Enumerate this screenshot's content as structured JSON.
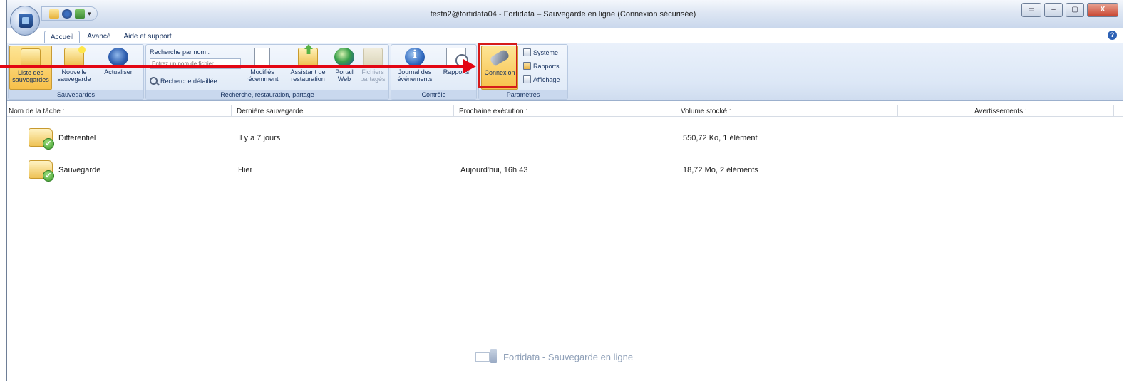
{
  "window": {
    "title": "testn2@fortidata04 - Fortidata – Sauvegarde en ligne (Connexion sécurisée)",
    "close_label": "X"
  },
  "tabs": [
    {
      "label": "Accueil",
      "active": true
    },
    {
      "label": "Avancé",
      "active": false
    },
    {
      "label": "Aide et support",
      "active": false
    }
  ],
  "help_label": "?",
  "ribbon": {
    "groups": {
      "sauvegardes": {
        "label": "Sauvegardes",
        "buttons": [
          {
            "line1": "Liste des",
            "line2": "sauvegardes",
            "selected": true,
            "icon": "folder-icon"
          },
          {
            "line1": "Nouvelle",
            "line2": "sauvegarde",
            "icon": "new-folder-icon"
          },
          {
            "line1": "Actualiser",
            "line2": "",
            "icon": "refresh-icon"
          }
        ]
      },
      "recherche": {
        "label": "Recherche, restauration, partage",
        "search_label": "Recherche par nom :",
        "search_placeholder": "Entrez un nom de fichier",
        "advanced_search": "Recherche détaillée...",
        "buttons": [
          {
            "line1": "Modifiés",
            "line2": "récemment",
            "icon": "recent-docs-icon"
          },
          {
            "line1": "Assistant de",
            "line2": "restauration",
            "icon": "restore-wizard-icon"
          },
          {
            "line1": "Portail",
            "line2": "Web",
            "icon": "globe-icon"
          },
          {
            "line1": "Fichiers",
            "line2": "partagés",
            "disabled": true,
            "icon": "shared-files-icon"
          }
        ]
      },
      "controle": {
        "label": "Contrôle",
        "buttons": [
          {
            "line1": "Journal des",
            "line2": "événements",
            "icon": "info-icon"
          },
          {
            "line1": "Rapports",
            "line2": "",
            "icon": "reports-icon"
          }
        ]
      },
      "parametres": {
        "label": "Paramètres",
        "connexion": "Connexion",
        "small_buttons": [
          "Système",
          "Rapports",
          "Affichage"
        ]
      }
    }
  },
  "list": {
    "columns": [
      "Nom de la tâche :",
      "Dernière sauvegarde :",
      "Prochaine exécution :",
      "Volume stocké :",
      "Avertissements :"
    ],
    "rows": [
      {
        "name": "Differentiel",
        "last": "Il y a 7 jours",
        "next": "",
        "volume": "550,72 Ko, 1 élément",
        "warnings": ""
      },
      {
        "name": "Sauvegarde",
        "last": "Hier",
        "next": "Aujourd'hui, 16h 43",
        "volume": "18,72 Mo, 2 éléments",
        "warnings": ""
      }
    ]
  },
  "brand": {
    "text": "Fortidata - Sauvegarde en ligne"
  },
  "colors": {
    "accent": "#e30613",
    "ribbon": "#dce7f6",
    "selected": "#f7c04a"
  }
}
